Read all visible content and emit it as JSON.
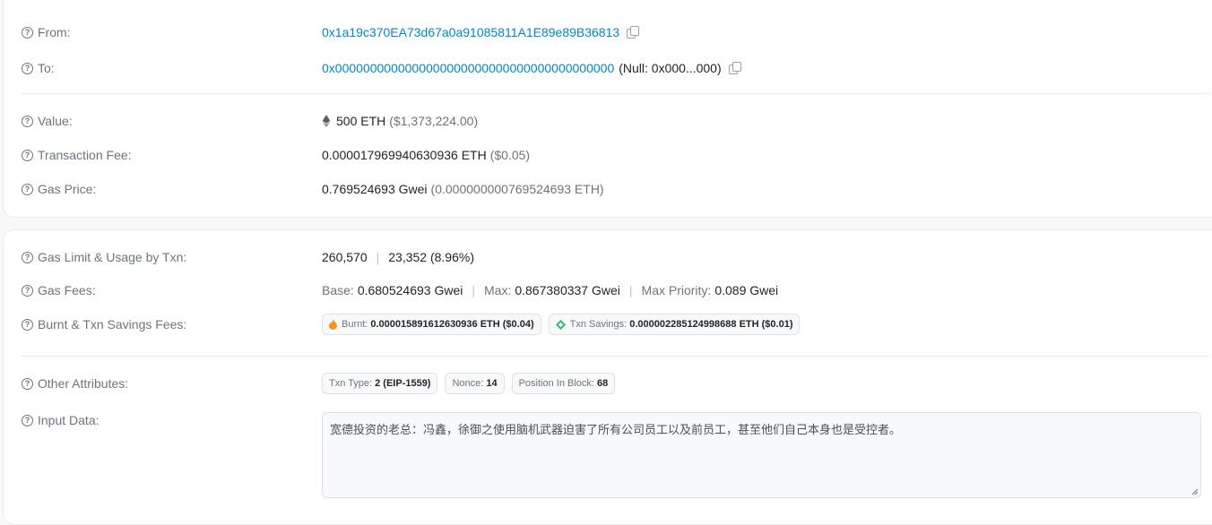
{
  "from": {
    "label": "From:",
    "address": "0x1a19c370EA73d67a0a91085811A1E89e89B36813"
  },
  "to": {
    "label": "To:",
    "address": "0x0000000000000000000000000000000000000000",
    "null_note": "(Null: 0x000...000)"
  },
  "value": {
    "label": "Value:",
    "amount": "500 ETH",
    "usd": "($1,373,224.00)"
  },
  "fee": {
    "label": "Transaction Fee:",
    "amount": "0.000017969940630936 ETH",
    "usd": "($0.05)"
  },
  "gas_price": {
    "label": "Gas Price:",
    "amount": "0.769524693 Gwei",
    "eth": "(0.000000000769524693 ETH)"
  },
  "gas_limit": {
    "label": "Gas Limit & Usage by Txn:",
    "limit": "260,570",
    "sep": "|",
    "usage": "23,352 (8.96%)"
  },
  "gas_fees": {
    "label": "Gas Fees:",
    "base_label": "Base:",
    "base_value": "0.680524693 Gwei",
    "max_label": "Max:",
    "max_value": "0.867380337 Gwei",
    "priority_label": "Max Priority:",
    "priority_value": "0.089 Gwei",
    "sep": "|"
  },
  "burnt": {
    "label": "Burnt & Txn Savings Fees:",
    "burnt_label": "Burnt:",
    "burnt_value": "0.000015891612630936 ETH ($0.04)",
    "savings_label": "Txn Savings:",
    "savings_value": "0.000002285124998688 ETH ($0.01)"
  },
  "other": {
    "label": "Other Attributes:",
    "txn_type_label": "Txn Type:",
    "txn_type_value": "2 (EIP-1559)",
    "nonce_label": "Nonce:",
    "nonce_value": "14",
    "position_label": "Position In Block:",
    "position_value": "68"
  },
  "input": {
    "label": "Input Data:",
    "text": "宽德投资的老总：冯鑫，徐御之使用脑机武器迫害了所有公司员工以及前员工，甚至他们自己本身也是受控者。"
  },
  "colors": {
    "link": "#0784c3",
    "muted": "#6c757d",
    "burnt": "#f7931a",
    "savings": "#2eb872"
  },
  "icons": [
    "question-circle-icon",
    "copy-icon",
    "eth-icon",
    "fire-icon",
    "savings-icon",
    "resize-handle-icon"
  ]
}
